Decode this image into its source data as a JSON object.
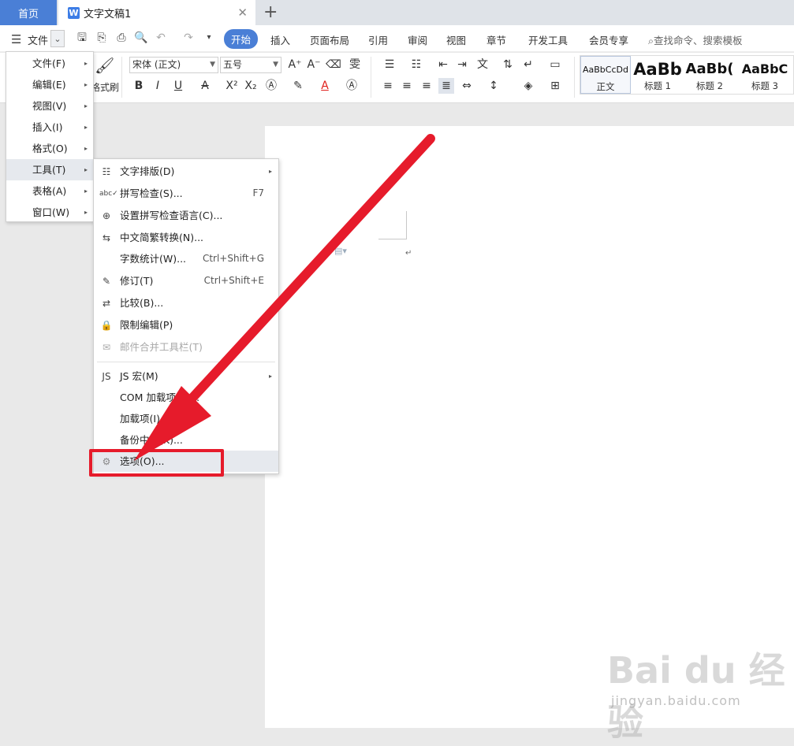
{
  "tabs": {
    "home": "首页",
    "doc_icon": "W",
    "doc_title": "文字文稿1",
    "close": "✕",
    "add": "+"
  },
  "menu_row": {
    "file_label": "文件",
    "tabs": [
      "开始",
      "插入",
      "页面布局",
      "引用",
      "审阅",
      "视图",
      "章节",
      "开发工具",
      "会员专享"
    ],
    "active_tab": "开始",
    "search_placeholder": "查找命令、搜索模板"
  },
  "ribbon": {
    "font_name": "宋体 (正文)",
    "font_size": "五号",
    "format_painter": "格式刷",
    "styles": [
      {
        "sample": "AaBbCcDd",
        "name": "正文"
      },
      {
        "sample": "AaBb",
        "name": "标题 1"
      },
      {
        "sample": "AaBb(",
        "name": "标题 2"
      },
      {
        "sample": "AaBbC",
        "name": "标题 3"
      }
    ]
  },
  "main_menu": [
    {
      "label": "文件(F)"
    },
    {
      "label": "编辑(E)"
    },
    {
      "label": "视图(V)"
    },
    {
      "label": "插入(I)"
    },
    {
      "label": "格式(O)"
    },
    {
      "label": "工具(T)"
    },
    {
      "label": "表格(A)"
    },
    {
      "label": "窗口(W)"
    }
  ],
  "tools_submenu": [
    {
      "label": "文字排版(D)",
      "shortcut": "",
      "icon": "text-layout-icon"
    },
    {
      "label": "拼写检查(S)...",
      "shortcut": "F7",
      "icon": "spellcheck-icon"
    },
    {
      "label": "设置拼写检查语言(C)...",
      "shortcut": "",
      "icon": "language-icon"
    },
    {
      "label": "中文简繁转换(N)...",
      "shortcut": "",
      "icon": "convert-icon"
    },
    {
      "label": "字数统计(W)...",
      "shortcut": "Ctrl+Shift+G",
      "icon": ""
    },
    {
      "label": "修订(T)",
      "shortcut": "Ctrl+Shift+E",
      "icon": "revision-icon"
    },
    {
      "label": "比较(B)...",
      "shortcut": "",
      "icon": "compare-icon"
    },
    {
      "label": "限制编辑(P)",
      "shortcut": "",
      "icon": "restrict-icon"
    },
    {
      "label": "邮件合并工具栏(T)",
      "shortcut": "",
      "icon": "mail-icon"
    },
    {
      "label": "JS 宏(M)",
      "shortcut": "",
      "icon": "js-macro-icon"
    },
    {
      "label": "COM 加载项(A)...",
      "shortcut": "",
      "icon": ""
    },
    {
      "label": "加载项(I)...",
      "shortcut": "",
      "icon": ""
    },
    {
      "label": "备份中心(K)...",
      "shortcut": "",
      "icon": ""
    },
    {
      "label": "选项(O)...",
      "shortcut": "",
      "icon": "gear-icon"
    }
  ],
  "watermark": {
    "logo": "Bai du 经验",
    "url": "jingyan.baidu.com"
  },
  "colors": {
    "accent": "#4a7fd6",
    "annotation_red": "#e61b2b"
  }
}
